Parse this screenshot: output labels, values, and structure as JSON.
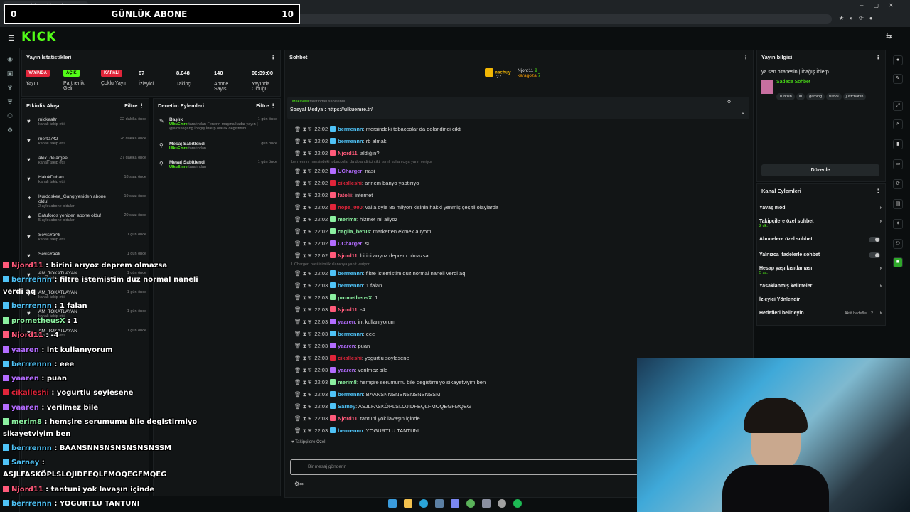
{
  "browser": {
    "tab_title": "Stream - Kick Dashboard",
    "url": "https://dashboard.kick.com/stream",
    "overlay": {
      "left": "0",
      "label": "GÜNLÜK ABONE",
      "right": "10"
    }
  },
  "app": {
    "logo": "KICK"
  },
  "stats": {
    "title": "Yayın İstatistikleri",
    "items": [
      {
        "badge": "YAYINDA",
        "badge_color": "#e0253a",
        "label": "Yayın"
      },
      {
        "badge": "AÇIK",
        "badge_color": "#53fc18",
        "label": "Partnerlik Gelir"
      },
      {
        "badge": "KAPALI",
        "badge_color": "#e0253a",
        "label": "Çoklu Yayın"
      },
      {
        "value": "67",
        "label": "İzleyici"
      },
      {
        "value": "8.048",
        "label": "Takipçi"
      },
      {
        "value": "140",
        "label": "Abone Sayısı"
      },
      {
        "value": "00:39:00",
        "label": "Yayında Olduğu"
      }
    ]
  },
  "activity": {
    "title": "Etkinlik Akışı",
    "filter": "Filtre",
    "events": [
      {
        "user": "mickealtr",
        "sub": "kanalı takip etti",
        "time": "22 dakika önce"
      },
      {
        "user": "mert0742",
        "sub": "kanalı takip etti",
        "time": "28 dakika önce"
      },
      {
        "user": "alex_delargee",
        "sub": "kanalı takip etti",
        "time": "37 dakika önce"
      },
      {
        "user": "HalukDuhan",
        "sub": "kanalı takip etti",
        "time": "18 saat önce"
      },
      {
        "user": "Kurdoskee_Gang yeniden abone oldu!",
        "sub": "2 aylık abone oldular",
        "time": "19 saat önce"
      },
      {
        "user": "Batuforos yeniden abone oldu!",
        "sub": "5 aylık abone oldular",
        "time": "20 saat önce"
      },
      {
        "user": "SevisYaAli",
        "sub": "kanalı takip etti",
        "time": "1 gün önce"
      },
      {
        "user": "SevisYaAli",
        "sub": "",
        "time": "1 gün önce"
      },
      {
        "user": "AM_TOKATLAYAN",
        "sub": "kanalı takip etti",
        "time": "1 gün önce"
      },
      {
        "user": "AM_TOKATLAYAN",
        "sub": "kanalı takip etti",
        "time": "1 gün önce"
      },
      {
        "user": "AM_TOKATLAYAN",
        "sub": "kanalı takip etti",
        "time": "1 gün önce"
      },
      {
        "user": "AM_TOKATLAYAN",
        "sub": "kanalı takip etti",
        "time": "1 gün önce"
      }
    ]
  },
  "moderation": {
    "title": "Denetim Eylemleri",
    "filter": "Filtre",
    "events": [
      {
        "title": "Başlık",
        "by": "UlkuEmre",
        "desc": "tarafından Fenerin maçına kadar yayın | @aloskegang İbağış İblerp olarak değiştirildi",
        "time": "1 gün önce"
      },
      {
        "title": "Mesaj Sabitlendi",
        "by": "UlkuEmre",
        "desc": "tarafından",
        "time": "1 gün önce"
      },
      {
        "title": "Mesaj Sabitlendi",
        "by": "UlkuEmre",
        "desc": "tarafından",
        "time": "1 gün önce"
      }
    ]
  },
  "chat": {
    "title": "Sohbet",
    "leaderboard": [
      {
        "name": "nachuy",
        "count": "27"
      },
      {
        "name": "Njord11",
        "count": "9"
      },
      {
        "name": "karagoza",
        "count": "7"
      }
    ],
    "pinned": {
      "by": "1Makavelli",
      "by_suffix": "tarafından sabitlendi",
      "text_label": "Sosyal Medya :",
      "text_link": "https://ulkuemre.tr/"
    },
    "messages": [
      {
        "time": "22:02",
        "user": "berrrennn",
        "color": "#4fc3f7",
        "text": ": mersindeki tobaccolar da dolandirici cikti"
      },
      {
        "time": "22:02",
        "user": "berrrennn",
        "color": "#4fc3f7",
        "text": ": rb almak"
      },
      {
        "time": "22:02",
        "user": "Njord11",
        "color": "#ff5a7a",
        "text": ": aldığın?"
      },
      {
        "reply": "berrrennn: mersindeki tobaccolar da dolandirici cikti isimli kullanıcıya yanıt veriyor"
      },
      {
        "time": "22:02",
        "user": "UCharger",
        "color": "#b36cff",
        "text": ": nasi"
      },
      {
        "time": "22:02",
        "user": "cikalleshi",
        "color": "#e0253a",
        "text": ": annem banyo yaptırıyo"
      },
      {
        "time": "22:02",
        "user": "fatolii",
        "color": "#ff5a7a",
        "text": ": internet"
      },
      {
        "time": "22:02",
        "user": "nope_000",
        "color": "#e0253a",
        "text": ": valla oyle 85 milyon kisinin hakki yenmiş çeşitli olaylarda"
      },
      {
        "time": "22:02",
        "user": "merim8",
        "color": "#8bf0a0",
        "text": ": hizmet mi aliyoz"
      },
      {
        "time": "22:02",
        "user": "caglia_betus",
        "color": "#8bf0a0",
        "text": ": marketten ekmek alıyom"
      },
      {
        "time": "22:02",
        "user": "UCharger",
        "color": "#b36cff",
        "text": ": su"
      },
      {
        "time": "22:02",
        "user": "Njord11",
        "color": "#ff5a7a",
        "text": ": birini arıyoz deprem olmazsa"
      },
      {
        "reply": "UCharger: nasi isimli kullanıcıya yanıt veriyor"
      },
      {
        "time": "22:02",
        "user": "berrrennn",
        "color": "#4fc3f7",
        "text": ": filtre istemistim duz normal naneli verdi aq"
      },
      {
        "time": "22:03",
        "user": "berrrennn",
        "color": "#4fc3f7",
        "text": ": 1 falan"
      },
      {
        "time": "22:03",
        "user": "prometheusX",
        "color": "#8bf0a0",
        "text": ": 1"
      },
      {
        "time": "22:03",
        "user": "Njord11",
        "color": "#ff5a7a",
        "text": ": -4"
      },
      {
        "time": "22:03",
        "user": "yaaren",
        "color": "#b36cff",
        "text": ": int kullanıyorum"
      },
      {
        "time": "22:03",
        "user": "berrrennn",
        "color": "#4fc3f7",
        "text": ": eee"
      },
      {
        "time": "22:03",
        "user": "yaaren",
        "color": "#b36cff",
        "text": ": puan"
      },
      {
        "time": "22:03",
        "user": "cikalleshi",
        "color": "#e0253a",
        "text": ": yogurtlu soylesene"
      },
      {
        "time": "22:03",
        "user": "yaaren",
        "color": "#b36cff",
        "text": ": verilmez bile"
      },
      {
        "time": "22:03",
        "user": "merim8",
        "color": "#8bf0a0",
        "text": ": hemşire serumumu bile degistirmiyo sikayetviyim ben"
      },
      {
        "time": "22:03",
        "user": "berrrennn",
        "color": "#4fc3f7",
        "text": ": BAANSNNSNSNSNSNSNSSM"
      },
      {
        "time": "22:03",
        "user": "Sarney",
        "color": "#4fc3f7",
        "text": ": ASJLFASKÖPLSLOJIDFEQLFMOQEGFMQEG"
      },
      {
        "time": "22:03",
        "user": "Njord11",
        "color": "#ff5a7a",
        "text": ": tantuni yok lavaşın içinde"
      },
      {
        "time": "22:03",
        "user": "berrrennn",
        "color": "#4fc3f7",
        "text": ": YOGURTLU TANTUNI"
      }
    ],
    "followers_only": "Takipçilere Özel",
    "input_placeholder": "Bir mesaj gönderin"
  },
  "overlay_chat": [
    {
      "user": "Njord11",
      "color": "#ff5a7a",
      "text": " : birini arıyoz deprem olmazsa"
    },
    {
      "user": "berrrennn",
      "color": "#4fc3f7",
      "text": " : filtre istemistim duz normal naneli"
    },
    {
      "user": "",
      "color": "#fff",
      "text": "verdi aq"
    },
    {
      "user": "berrrennn",
      "color": "#4fc3f7",
      "text": " : 1 falan"
    },
    {
      "user": "prometheusX",
      "color": "#8bf0a0",
      "text": " : 1"
    },
    {
      "user": "Njord11",
      "color": "#ff5a7a",
      "text": " : -4"
    },
    {
      "user": "yaaren",
      "color": "#b36cff",
      "text": " : int kullanıyorum"
    },
    {
      "user": "berrrennn",
      "color": "#4fc3f7",
      "text": " : eee"
    },
    {
      "user": "yaaren",
      "color": "#b36cff",
      "text": " : puan"
    },
    {
      "user": "cikalleshi",
      "color": "#e0253a",
      "text": " : yogurtlu soylesene"
    },
    {
      "user": "yaaren",
      "color": "#b36cff",
      "text": " : verilmez bile"
    },
    {
      "user": "merim8",
      "color": "#8bf0a0",
      "text": " : hemşire serumumu bile degistirmiyo"
    },
    {
      "user": "",
      "color": "#fff",
      "text": "sikayetviyim ben"
    },
    {
      "user": "berrrennn",
      "color": "#4fc3f7",
      "text": " : BAANSNNSNSNSNSNSNSSM"
    },
    {
      "user": "Sarney",
      "color": "#4fc3f7",
      "text": " :"
    },
    {
      "user": "",
      "color": "#fff",
      "text": "ASJLFASKÖPLSLOJIDFEQLFMOQEGFMQEG"
    },
    {
      "user": "Njord11",
      "color": "#ff5a7a",
      "text": " : tantuni yok lavaşın içinde"
    },
    {
      "user": "berrrennn",
      "color": "#4fc3f7",
      "text": " : YOGURTLU TANTUNI"
    }
  ],
  "stream_info": {
    "title": "Yayın bilgisi",
    "stream_title": "ya sen bitanesin | İbağış İblerp",
    "category": "Sadece Sohbet",
    "tags": [
      "Turkish",
      "irl",
      "gaming",
      "futbol",
      "justchattin"
    ],
    "edit_button": "Düzenle"
  },
  "channel_actions": {
    "title": "Kanal Eylemleri",
    "rows": [
      {
        "label": "Yavaş mod",
        "sub": "",
        "control": "chevron"
      },
      {
        "label": "Takipçilere özel sohbet",
        "sub": "2 dk.",
        "control": "chevron"
      },
      {
        "label": "Abonelere özel sohbet",
        "sub": "",
        "control": "toggle"
      },
      {
        "label": "Yalnızca ifadelerle sohbet",
        "sub": "",
        "control": "toggle"
      },
      {
        "label": "Hesap yaşı kısıtlaması",
        "sub": "5 sa.",
        "control": "chevron"
      },
      {
        "label": "Yasaklanmış kelimeler",
        "sub": "",
        "control": "chevron"
      },
      {
        "label": "İzleyici Yönlendir",
        "sub": "",
        "control": "none"
      },
      {
        "label": "Hedefleri belirleyin",
        "sub": "",
        "control": "chevron",
        "extra": "Aktif hedefler · 2"
      }
    ]
  }
}
